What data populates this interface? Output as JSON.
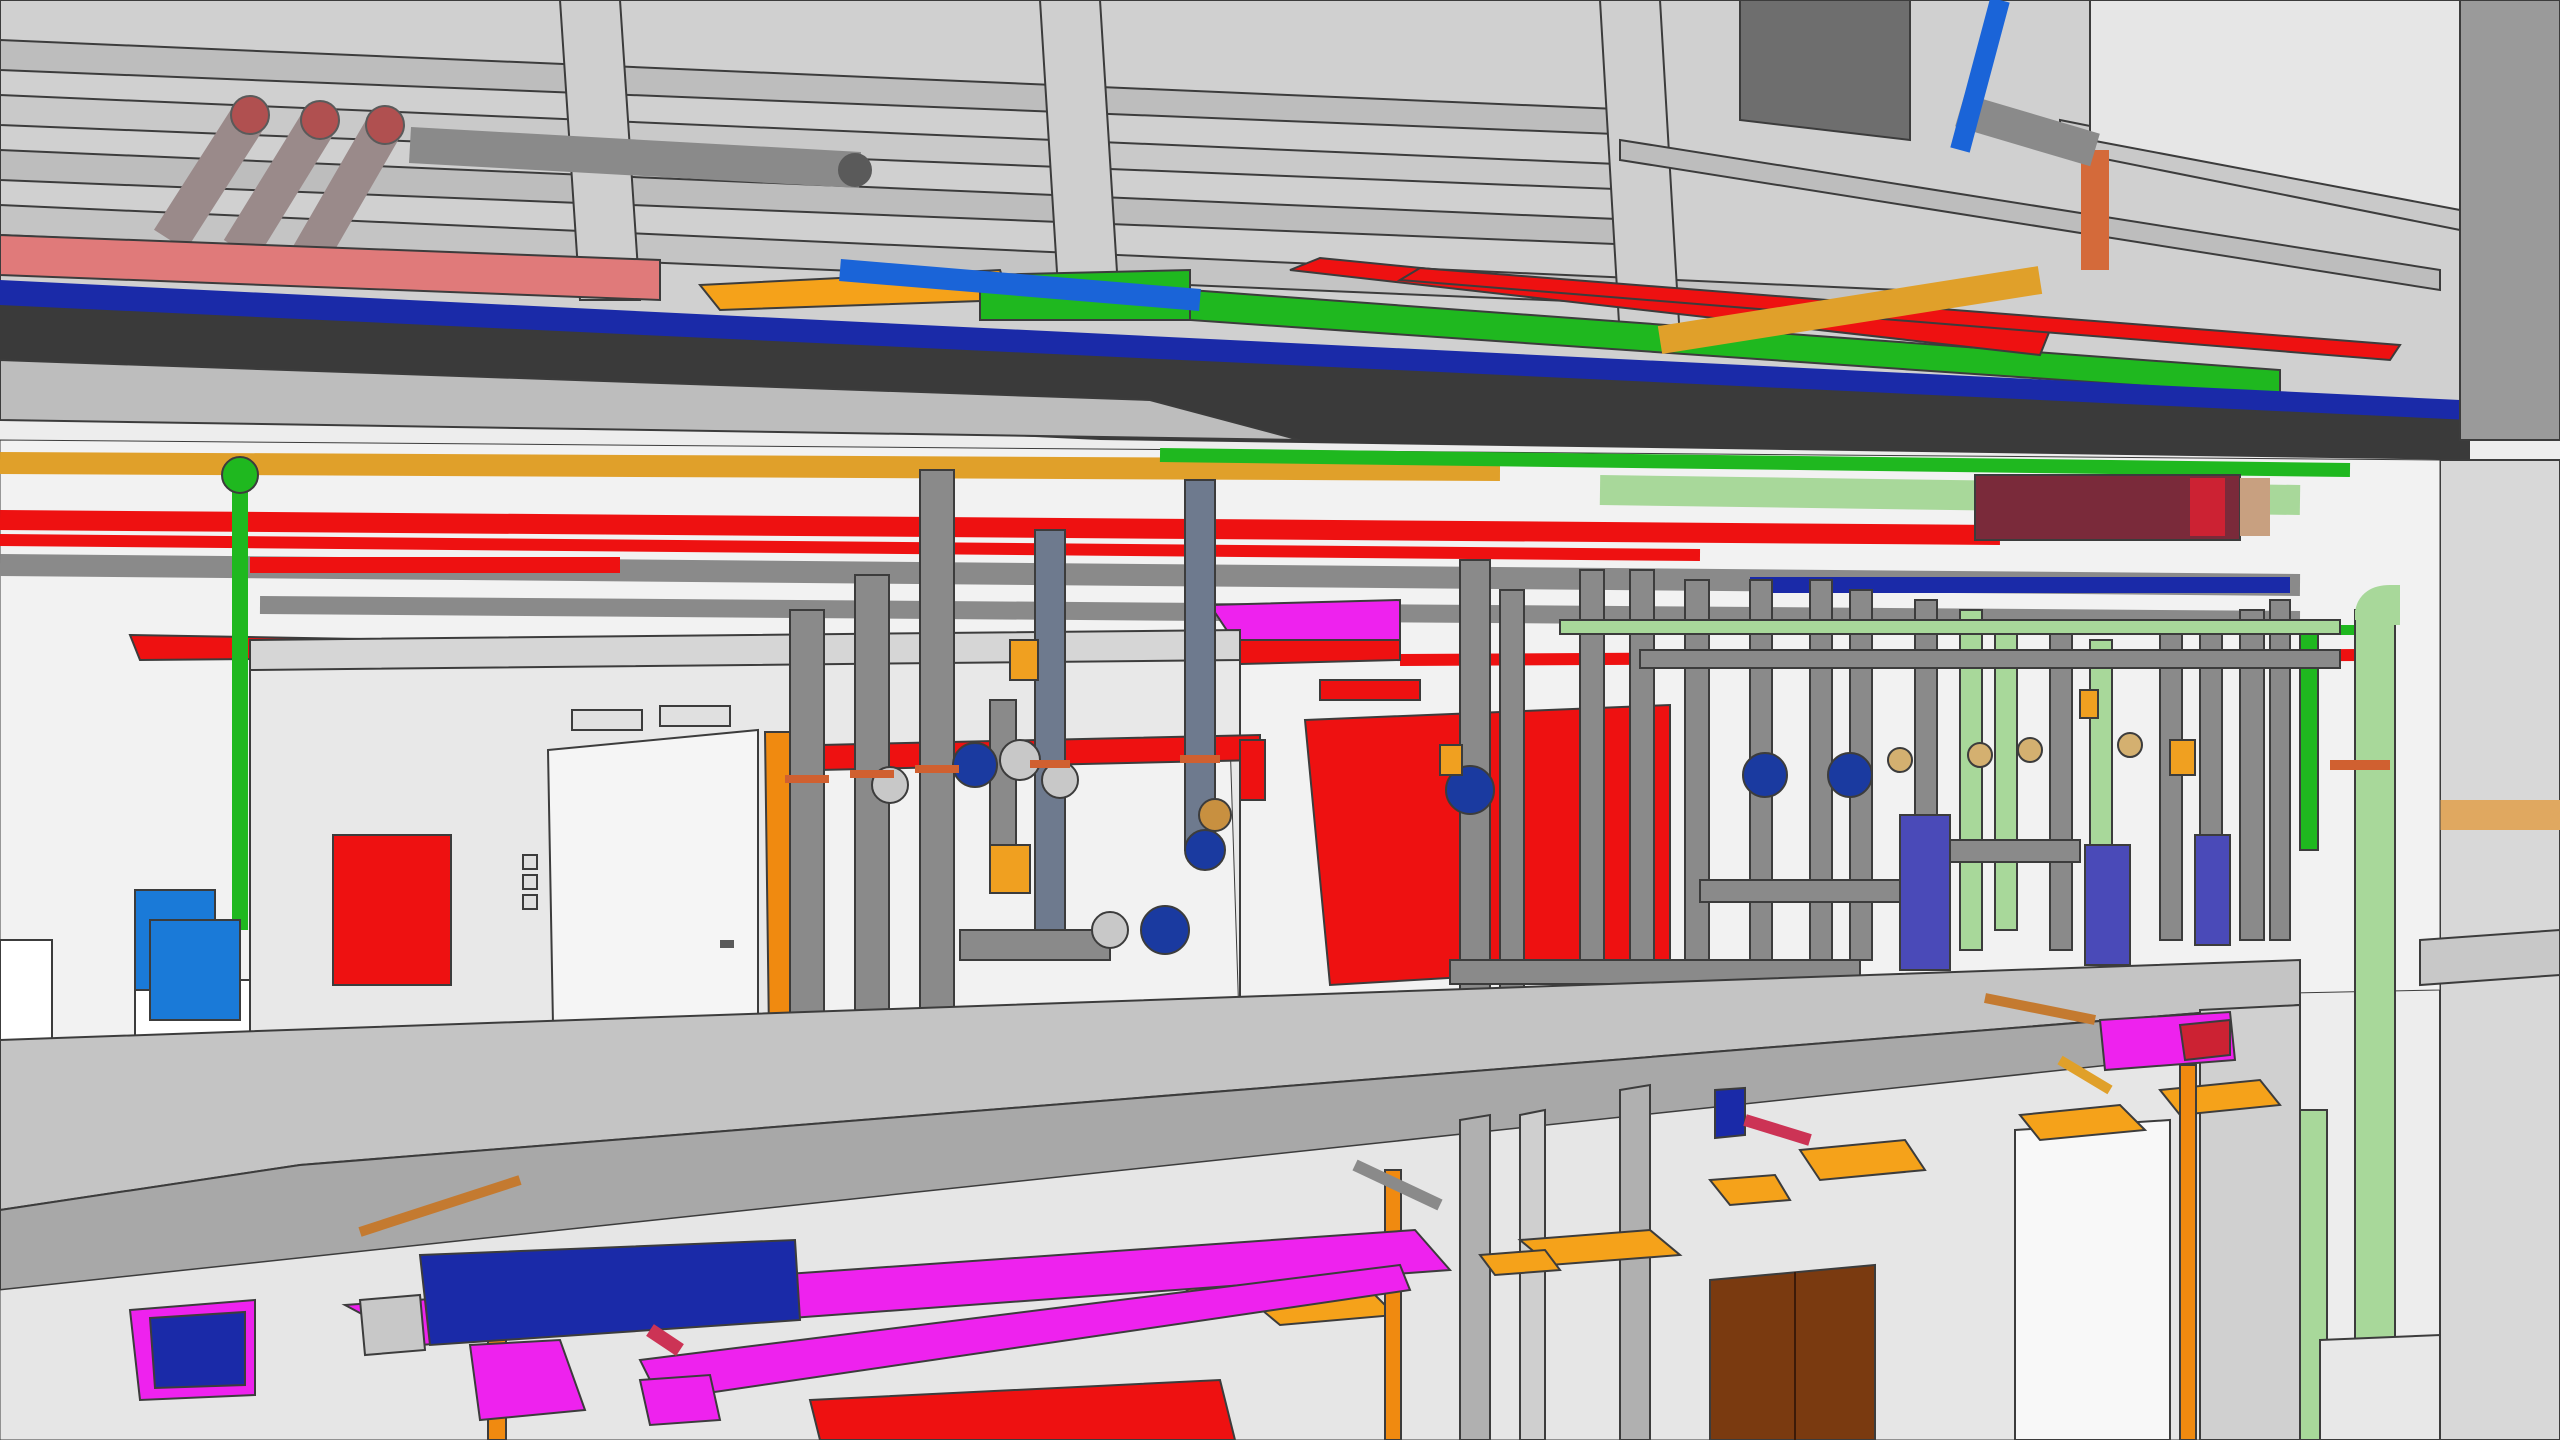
{
  "scene": {
    "description_visible_text": "",
    "colors": {
      "background": "#ededed",
      "structure_light": "#dcdcdc",
      "structure_mid": "#c4c4c4",
      "structure_dark": "#8e8e8e",
      "edge": "#3c3c3c",
      "pipe_grey": "#8a8a8a",
      "pipe_light_grey": "#b8b8b8",
      "heating_red": "#ee1111",
      "supply_orange": "#f5a21a",
      "gas_yellow_orange": "#e0a02a",
      "green": "#1fb81f",
      "light_green": "#a8d89a",
      "blue": "#1a64d8",
      "dark_blue": "#1a2aa8",
      "magenta": "#ee22ee",
      "pink_duct": "#e07a7a",
      "brown_door": "#7a3a10",
      "pump_blue": "#1a3aa0",
      "valve_orange": "#f0a020"
    }
  }
}
